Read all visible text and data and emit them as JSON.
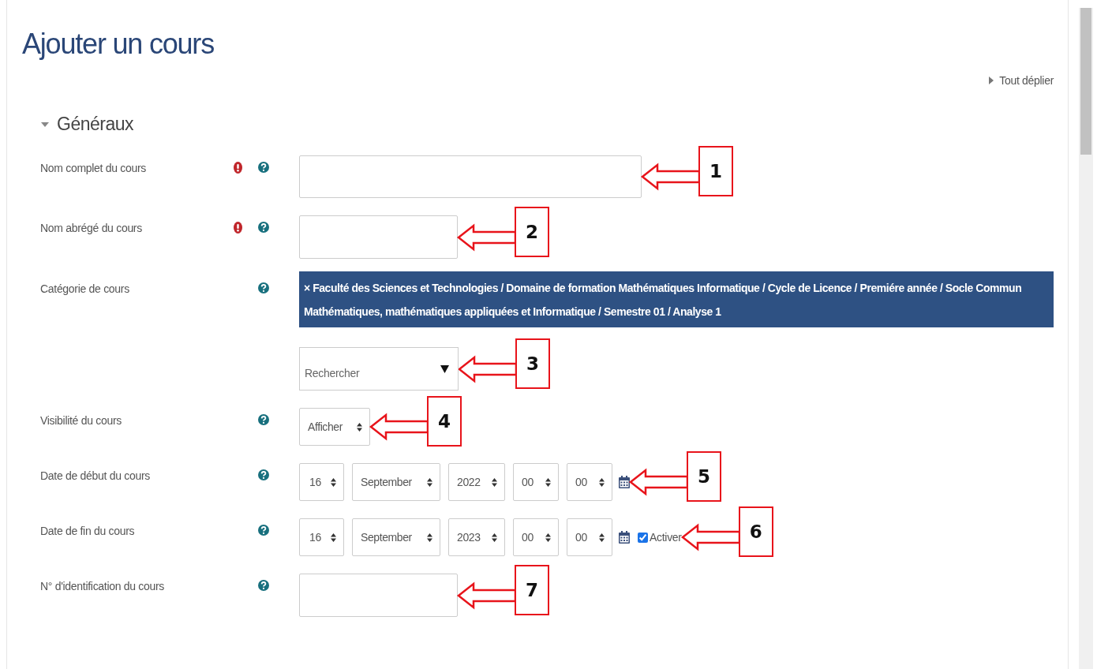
{
  "page_title": "Ajouter un cours",
  "expand_all": "Tout déplier",
  "section": {
    "title": "Généraux",
    "expanded": true
  },
  "rows": [
    {
      "kind": "wide-text",
      "label": "Nom complet du cours",
      "required": true,
      "callout": "1"
    },
    {
      "kind": "short-text",
      "label": "Nom abrégé du cours",
      "required": true,
      "callout": "2"
    },
    {
      "kind": "category",
      "label": "Catégorie de cours",
      "required": false,
      "chip": "× Faculté des Sciences et Technologies / Domaine de formation Mathématiques Informatique / Cycle de Licence / Premiére année / Socle Commun Mathématiques, mathématiques appliquées et Informatique / Semestre 01 / Analyse 1",
      "placeholder": "Rechercher",
      "callout": "3"
    },
    {
      "kind": "select",
      "label": "Visibilité du cours",
      "required": false,
      "value": "Afficher",
      "callout": "4"
    },
    {
      "kind": "date",
      "label": "Date de début du cours",
      "required": false,
      "parts": [
        "16",
        "September",
        "2022",
        "00",
        "00"
      ],
      "callout": "5"
    },
    {
      "kind": "date",
      "label": "Date de fin du cours",
      "required": false,
      "parts": [
        "16",
        "September",
        "2023",
        "00",
        "00"
      ],
      "enable": {
        "label": "Activer",
        "checked": true
      },
      "callout": "6"
    },
    {
      "kind": "short-text",
      "label": "N° d'identification du cours",
      "required": false,
      "callout": "7"
    }
  ]
}
